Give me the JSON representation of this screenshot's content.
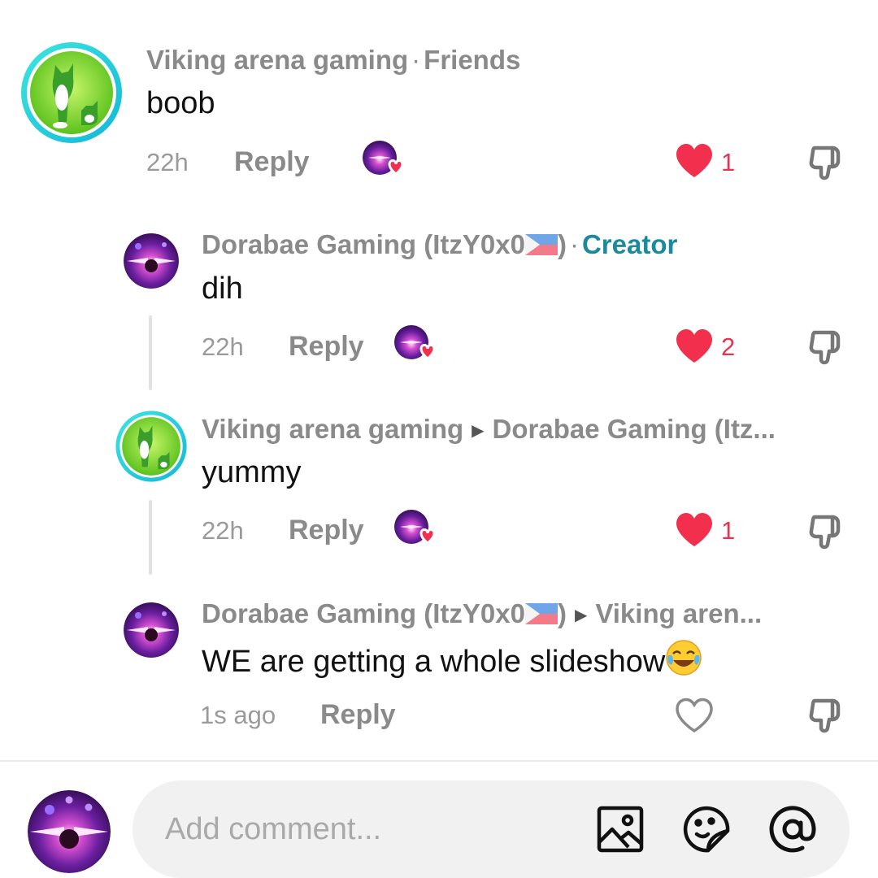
{
  "comments": [
    {
      "author": "Viking arena gaming",
      "tag": "Friends",
      "text": "boob",
      "time": "22h",
      "reply_label": "Reply",
      "likes": "1",
      "liked": true
    },
    {
      "author": "Dorabae Gaming (ItzY0x0",
      "author_suffix": ")",
      "tag": "Creator",
      "text": "dih",
      "time": "22h",
      "reply_label": "Reply",
      "likes": "2",
      "liked": true
    },
    {
      "author": "Viking arena gaming",
      "reply_to": "Dorabae Gaming (Itz...",
      "text": "yummy",
      "time": "22h",
      "reply_label": "Reply",
      "likes": "1",
      "liked": true
    },
    {
      "author": "Dorabae Gaming (ItzY0x0",
      "author_suffix": ")",
      "reply_to": "Viking aren...",
      "text": "WE are getting a whole slideshow",
      "time": "1s ago",
      "reply_label": "Reply",
      "likes": "",
      "liked": false
    }
  ],
  "composer": {
    "placeholder": "Add comment..."
  },
  "icons": {
    "liked_by": "creator-liked-avatar-icon",
    "heart": "heart-icon",
    "dislike": "thumbs-down-icon",
    "image": "image-icon",
    "sticker": "sticker-emoji-icon",
    "mention": "at-mention-icon",
    "flag": "philippines-flag-icon",
    "emoji": "laughing-tears-emoji-icon"
  },
  "colors": {
    "heart_active": "#f2304d",
    "creator_tag": "#1c8a9c",
    "muted_text": "#8a8a8a"
  }
}
